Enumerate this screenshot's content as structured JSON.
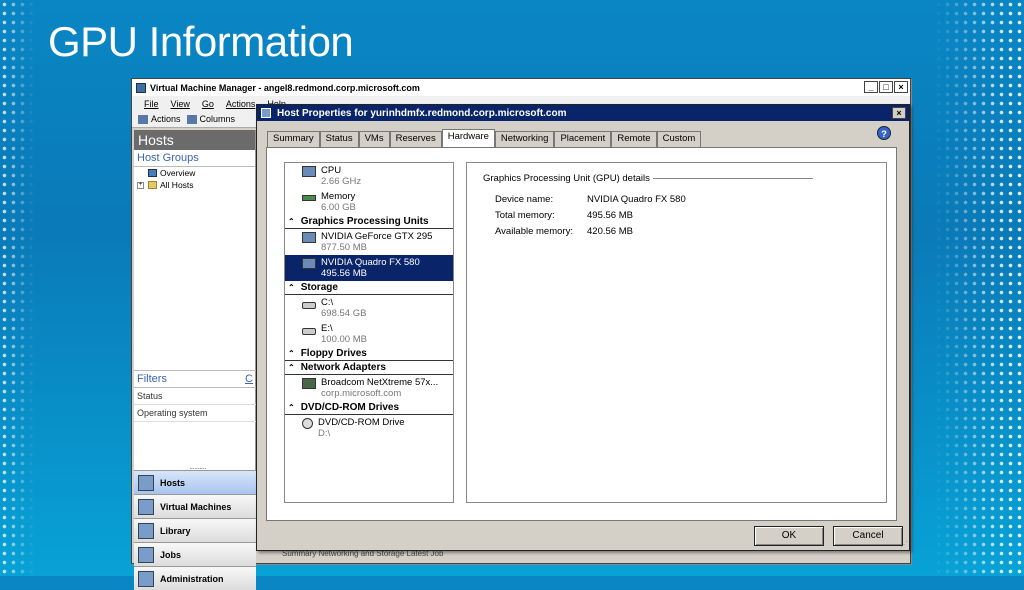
{
  "slide_title": "GPU Information",
  "vmm": {
    "title": "Virtual Machine Manager - angel8.redmond.corp.microsoft.com",
    "menu": [
      "File",
      "View",
      "Go",
      "Actions",
      "Help"
    ],
    "toolbar": {
      "actions": "Actions",
      "columns": "Columns"
    },
    "left": {
      "header": "Hosts",
      "host_groups": "Host Groups",
      "tree": [
        {
          "label": "Overview"
        },
        {
          "label": "All Hosts"
        }
      ],
      "filters_label": "Filters",
      "filters_link": "C",
      "filter_rows": [
        "Status",
        "Operating system"
      ],
      "grip": "··········",
      "nav": [
        {
          "label": "Hosts",
          "icon": "hosts-icon"
        },
        {
          "label": "Virtual Machines",
          "icon": "virtual-machines-icon"
        },
        {
          "label": "Library",
          "icon": "library-icon"
        },
        {
          "label": "Jobs",
          "icon": "jobs-icon"
        },
        {
          "label": "Administration",
          "icon": "administration-icon"
        }
      ]
    },
    "bottom_tabs": "Summary  Networking and Storage  Latest Job"
  },
  "dialog": {
    "title": "Host Properties for yurinhdmfx.redmond.corp.microsoft.com",
    "tabs": [
      "Summary",
      "Status",
      "VMs",
      "Reserves",
      "Hardware",
      "Networking",
      "Placement",
      "Remote",
      "Custom"
    ],
    "active_tab": "Hardware",
    "hardware": {
      "cpu": {
        "name": "CPU",
        "sub": "2.66 GHz"
      },
      "memory": {
        "name": "Memory",
        "sub": "6.00 GB"
      },
      "gpu_category": "Graphics Processing Units",
      "gpus": [
        {
          "name": "NVIDIA GeForce GTX 295",
          "sub": "877.50 MB"
        },
        {
          "name": "NVIDIA Quadro FX 580",
          "sub": "495.56 MB"
        }
      ],
      "storage_category": "Storage",
      "disks": [
        {
          "name": "C:\\",
          "sub": "698.54 GB"
        },
        {
          "name": "E:\\",
          "sub": "100.00 MB"
        }
      ],
      "floppy_category": "Floppy Drives",
      "network_category": "Network Adapters",
      "network": {
        "name": "Broadcom NetXtreme 57x...",
        "sub": "corp.microsoft.com"
      },
      "dvd_category": "DVD/CD-ROM Drives",
      "dvd": {
        "name": "DVD/CD-ROM Drive",
        "sub": "D:\\"
      }
    },
    "details": {
      "header": "Graphics Processing Unit (GPU) details",
      "device_label": "Device name:",
      "device_value": "NVIDIA Quadro FX 580",
      "total_label": "Total memory:",
      "total_value": "495.56 MB",
      "avail_label": "Available memory:",
      "avail_value": "420.56 MB"
    },
    "ok": "OK",
    "cancel": "Cancel",
    "help": "?"
  }
}
